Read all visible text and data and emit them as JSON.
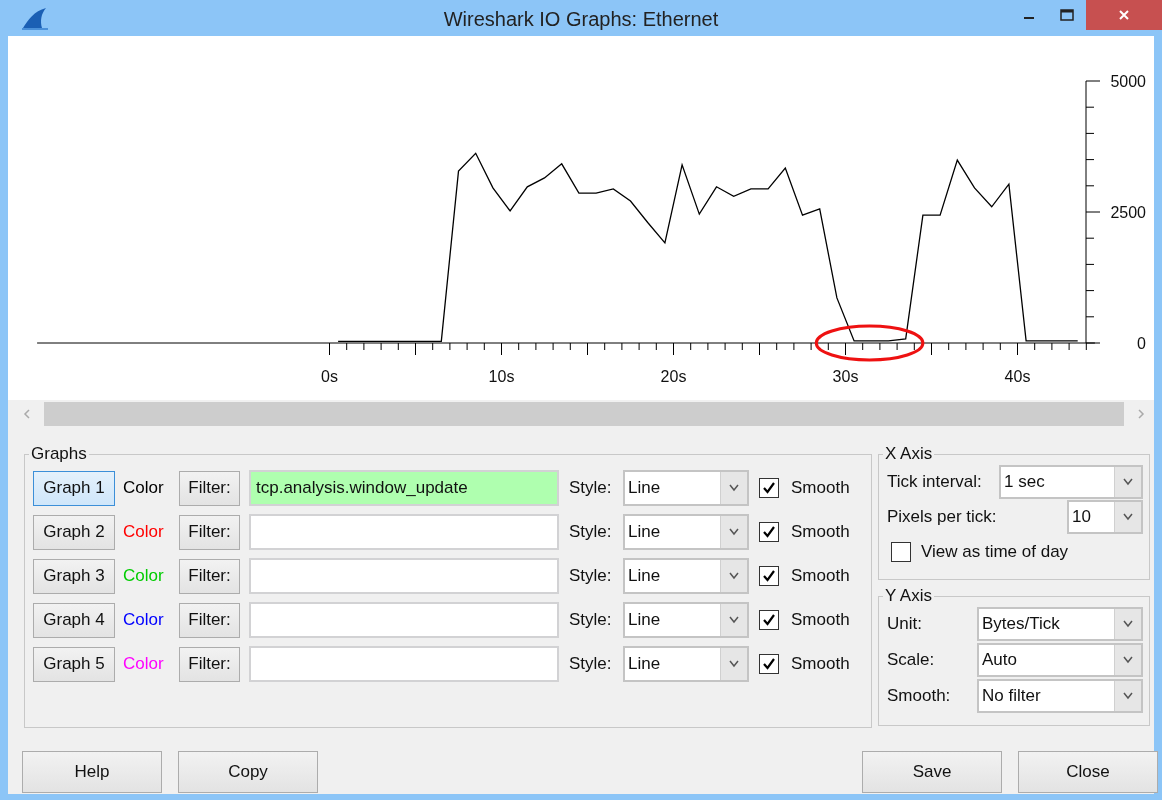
{
  "window": {
    "title": "Wireshark IO Graphs: Ethernet"
  },
  "chart": {
    "chart_data": {
      "type": "line",
      "x": [
        0.5,
        1.5,
        2.5,
        3.5,
        4.5,
        5.5,
        6.5,
        7.5,
        8.5,
        9.5,
        10.5,
        11.5,
        12.5,
        13.5,
        14.5,
        15.5,
        16.5,
        17.5,
        18.5,
        19.5,
        20.5,
        21.5,
        22.5,
        23.5,
        24.5,
        25.5,
        26.5,
        27.5,
        28.5,
        29.5,
        30.5,
        31.5,
        32.5,
        33.5,
        34.5,
        35.5,
        36.5,
        37.5,
        38.5,
        39.5,
        40.5,
        41.5,
        42.5,
        43.5
      ],
      "series": [
        {
          "color": "#000000",
          "values": [
            30,
            30,
            30,
            30,
            30,
            30,
            30,
            3280,
            3620,
            2960,
            2520,
            2980,
            3150,
            3420,
            2860,
            2860,
            2940,
            2710,
            2300,
            1910,
            3400,
            2460,
            2980,
            2800,
            2940,
            2940,
            3340,
            2440,
            2560,
            860,
            40,
            40,
            40,
            80,
            2440,
            2440,
            3490,
            2960,
            2600,
            3030,
            40,
            40,
            40,
            40
          ]
        }
      ],
      "xlim": [
        -17,
        44.5
      ],
      "ylim": [
        0,
        5000
      ],
      "xticks": [
        {
          "value": 0,
          "label": "0s"
        },
        {
          "value": 10,
          "label": "10s"
        },
        {
          "value": 20,
          "label": "20s"
        },
        {
          "value": 30,
          "label": "30s"
        },
        {
          "value": 40,
          "label": "40s"
        }
      ],
      "yticks": [
        0,
        2500,
        5000
      ]
    }
  },
  "graphs": {
    "title": "Graphs",
    "rows": [
      {
        "button": "Graph 1",
        "selected": true,
        "color_label": "Color",
        "color": "#000000",
        "filter_button": "Filter:",
        "filter": "tcp.analysis.window_update",
        "filter_highlighted": true,
        "style_label": "Style:",
        "style": "Line",
        "smooth_label": "Smooth",
        "smooth": true
      },
      {
        "button": "Graph 2",
        "selected": false,
        "color_label": "Color",
        "color": "#ff0000",
        "filter_button": "Filter:",
        "filter_highlighted": false,
        "style_label": "Style:",
        "style": "Line",
        "smooth_label": "Smooth",
        "smooth": true
      },
      {
        "button": "Graph 3",
        "selected": false,
        "color_label": "Color",
        "color": "#00cc00",
        "filter_button": "Filter:",
        "filter_highlighted": false,
        "style_label": "Style:",
        "style": "Line",
        "smooth_label": "Smooth",
        "smooth": true
      },
      {
        "button": "Graph 4",
        "selected": false,
        "color_label": "Color",
        "color": "#0000ff",
        "filter_button": "Filter:",
        "filter_highlighted": false,
        "style_label": "Style:",
        "style": "Line",
        "smooth_label": "Smooth",
        "smooth": true
      },
      {
        "button": "Graph 5",
        "selected": false,
        "color_label": "Color",
        "color": "#ff00ff",
        "filter_button": "Filter:",
        "filter_highlighted": false,
        "style_label": "Style:",
        "style": "Line",
        "smooth_label": "Smooth",
        "smooth": true
      }
    ]
  },
  "x_axis": {
    "title": "X Axis",
    "tick_interval_label": "Tick interval:",
    "tick_interval": "1 sec",
    "pixels_per_tick_label": "Pixels per tick:",
    "pixels_per_tick": "10",
    "time_of_day_label": "View as time of day",
    "time_of_day": false
  },
  "y_axis": {
    "title": "Y Axis",
    "fields": [
      {
        "label": "Unit:",
        "value": "Bytes/Tick"
      },
      {
        "label": "Scale:",
        "value": "Auto"
      },
      {
        "label": "Smooth:",
        "value": "No filter"
      }
    ]
  },
  "buttons": [
    "Help",
    "Copy",
    "Save",
    "Close"
  ]
}
